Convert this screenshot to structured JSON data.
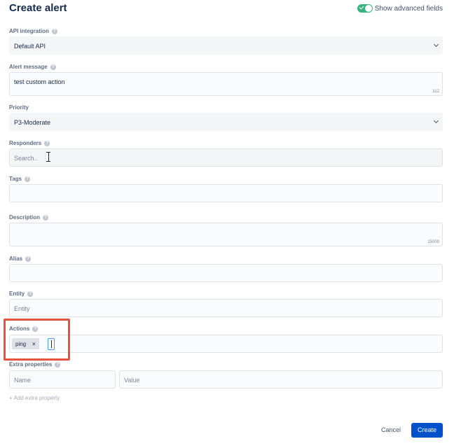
{
  "form": {
    "title": "Create alert"
  },
  "advanced": {
    "label": "Show advanced fields",
    "enabled": true
  },
  "api_integration": {
    "label": "API integration",
    "value": "Default API"
  },
  "alert_message": {
    "label": "Alert message",
    "value": "test custom action",
    "counter": "112"
  },
  "priority": {
    "label": "Priority",
    "value": "P3-Moderate"
  },
  "responders": {
    "label": "Responders",
    "placeholder": "Search.."
  },
  "tags": {
    "label": "Tags",
    "value": ""
  },
  "description": {
    "label": "Description",
    "value": "",
    "counter": "15000"
  },
  "alias": {
    "label": "Alias",
    "value": ""
  },
  "entity": {
    "label": "Entity",
    "placeholder": "Entity"
  },
  "actions": {
    "label": "Actions",
    "chips": [
      {
        "label": "ping",
        "remove": "×"
      }
    ]
  },
  "extra_properties": {
    "label": "Extra properties",
    "name_placeholder": "Name",
    "value_placeholder": "Value",
    "add_label": "+ Add extra property"
  },
  "buttons": {
    "cancel": "Cancel",
    "create": "Create"
  },
  "colors": {
    "primary": "#0052cc",
    "toggle_on": "#36b37e",
    "highlight": "#e5533d"
  }
}
